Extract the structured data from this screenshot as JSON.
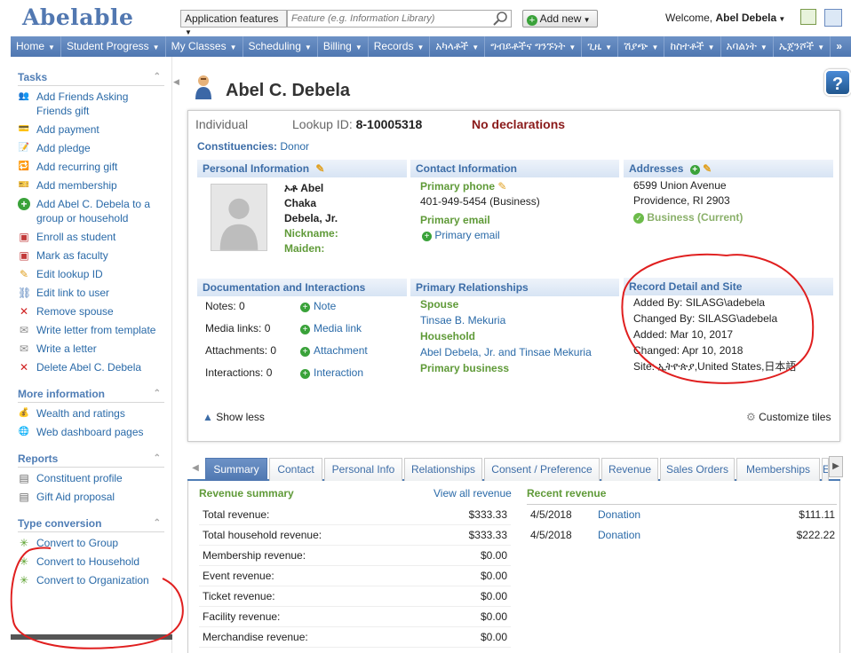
{
  "app": {
    "logo": "Abelable"
  },
  "topbar": {
    "feature_select": "Application features",
    "feature_placeholder": "Feature (e.g. Information Library)",
    "add_new": "Add new",
    "welcome_prefix": "Welcome,",
    "user": "Abel Debela"
  },
  "nav": {
    "items": [
      "Home",
      "Student Progress",
      "My Classes",
      "Scheduling",
      "Billing",
      "Records",
      "አካላቶች",
      "ግብይቶችና ግንኙነት",
      "ጊዜ",
      "ሽያጭ",
      "ከስተቶች",
      "አባልነት",
      "ኤጀንሾች"
    ],
    "more": "»"
  },
  "sidebar": {
    "tasks": {
      "title": "Tasks",
      "items": [
        {
          "label": "Add Friends Asking Friends gift",
          "icon": "people-icon"
        },
        {
          "label": "Add payment",
          "icon": "payment-icon"
        },
        {
          "label": "Add pledge",
          "icon": "pledge-icon"
        },
        {
          "label": "Add recurring gift",
          "icon": "recurring-gift-icon"
        },
        {
          "label": "Add membership",
          "icon": "membership-icon"
        },
        {
          "label": "Add Abel C. Debela to a group or household",
          "icon": "plus-circle-icon"
        },
        {
          "label": "Enroll as student",
          "icon": "enroll-icon"
        },
        {
          "label": "Mark as faculty",
          "icon": "faculty-icon"
        },
        {
          "label": "Edit lookup ID",
          "icon": "pencil-icon"
        },
        {
          "label": "Edit link to user",
          "icon": "link-icon"
        },
        {
          "label": "Remove spouse",
          "icon": "remove-x-icon"
        },
        {
          "label": "Write letter from template",
          "icon": "letter-template-icon"
        },
        {
          "label": "Write a letter",
          "icon": "letter-icon"
        },
        {
          "label": "Delete Abel C. Debela",
          "icon": "delete-x-icon"
        }
      ]
    },
    "more_info": {
      "title": "More information",
      "items": [
        {
          "label": "Wealth and ratings",
          "icon": "wealth-icon"
        },
        {
          "label": "Web dashboard pages",
          "icon": "web-icon"
        }
      ]
    },
    "reports": {
      "title": "Reports",
      "items": [
        {
          "label": "Constituent profile",
          "icon": "report-icon"
        },
        {
          "label": "Gift Aid proposal",
          "icon": "report-icon"
        }
      ]
    },
    "type_conversion": {
      "title": "Type conversion",
      "items": [
        {
          "label": "Convert to Group",
          "icon": "convert-icon"
        },
        {
          "label": "Convert to Household",
          "icon": "convert-icon"
        },
        {
          "label": "Convert to Organization",
          "icon": "convert-icon"
        }
      ]
    }
  },
  "record": {
    "name": "Abel C. Debela",
    "type": "Individual",
    "lookup_label": "Lookup ID:",
    "lookup_id": "8-10005318",
    "declarations": "No declarations",
    "constituencies_label": "Constituencies:",
    "constituencies_value": "Donor"
  },
  "personal": {
    "title": "Personal Information",
    "first": "ኦቶ Abel",
    "middle": "Chaka",
    "last": "Debela, Jr.",
    "nickname_label": "Nickname:",
    "maiden_label": "Maiden:"
  },
  "contact": {
    "title": "Contact Information",
    "phone_label": "Primary phone",
    "phone": "401-949-5454 (Business)",
    "email_label": "Primary email",
    "email_action": "Primary email"
  },
  "addresses": {
    "title": "Addresses",
    "line1": "6599 Union Avenue",
    "line2": "Providence, RI 2903",
    "status": "Business (Current)"
  },
  "documentation": {
    "title": "Documentation and Interactions",
    "rows": [
      {
        "label": "Notes: 0",
        "action": "Note"
      },
      {
        "label": "Media links: 0",
        "action": "Media link"
      },
      {
        "label": "Attachments: 0",
        "action": "Attachment"
      },
      {
        "label": "Interactions: 0",
        "action": "Interaction"
      }
    ]
  },
  "relationships": {
    "title": "Primary Relationships",
    "spouse_label": "Spouse",
    "spouse": "Tinsae B. Mekuria",
    "household_label": "Household",
    "household": "Abel Debela, Jr. and Tinsae Mekuria",
    "business_label": "Primary business"
  },
  "record_detail": {
    "title": "Record Detail and Site",
    "added_by": "Added By: SILASG\\adebela",
    "changed_by": "Changed By: SILASG\\adebela",
    "added": "Added: Mar 10, 2017",
    "changed": "Changed: Apr 10, 2018",
    "site": "Site: ኢትዮጵያ,United States,日本語"
  },
  "tiles_footer": {
    "show_less": "Show less",
    "customize": "Customize tiles"
  },
  "tabs": [
    "Summary",
    "Contact",
    "Personal Info",
    "Relationships",
    "Consent / Preference",
    "Revenue",
    "Sales Orders",
    "Memberships",
    "E"
  ],
  "revenue_summary": {
    "title": "Revenue summary",
    "view_all": "View all revenue",
    "rows": [
      {
        "label": "Total revenue:",
        "amount": "$333.33"
      },
      {
        "label": "Total household revenue:",
        "amount": "$333.33"
      },
      {
        "label": "Membership revenue:",
        "amount": "$0.00"
      },
      {
        "label": "Event revenue:",
        "amount": "$0.00"
      },
      {
        "label": "Ticket revenue:",
        "amount": "$0.00"
      },
      {
        "label": "Facility revenue:",
        "amount": "$0.00"
      },
      {
        "label": "Merchandise revenue:",
        "amount": "$0.00"
      }
    ]
  },
  "recent_revenue": {
    "title": "Recent revenue",
    "rows": [
      {
        "date": "4/5/2018",
        "type": "Donation",
        "amount": "$111.11"
      },
      {
        "date": "4/5/2018",
        "type": "Donation",
        "amount": "$222.22"
      }
    ]
  },
  "colors": {
    "nav": "#5a80b9",
    "link": "#2a6aa8",
    "green_label": "#5f9a38",
    "annotation": "#e01f1f"
  }
}
